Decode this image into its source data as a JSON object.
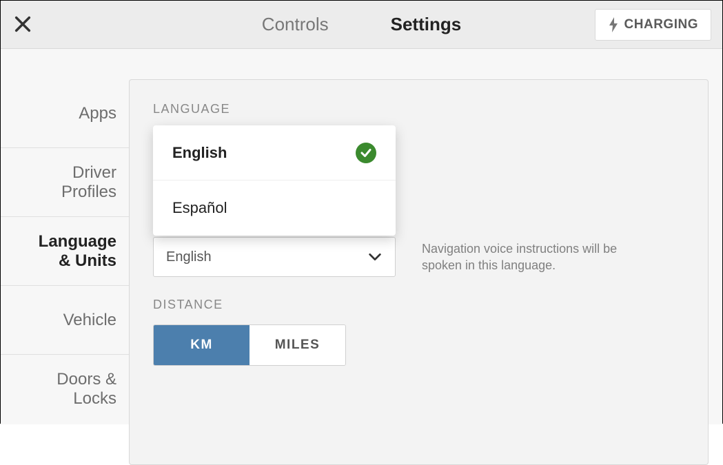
{
  "header": {
    "tabs": {
      "controls": "Controls",
      "settings": "Settings"
    },
    "charging": "CHARGING"
  },
  "sidebar": {
    "items": [
      {
        "label": "Apps"
      },
      {
        "label": "Driver\nProfiles"
      },
      {
        "label": "Language\n& Units"
      },
      {
        "label": "Vehicle"
      },
      {
        "label": "Doors &\nLocks"
      }
    ]
  },
  "sections": {
    "language_label": "LANGUAGE",
    "distance_label": "DISTANCE"
  },
  "language_dropdown": {
    "options": [
      {
        "label": "English",
        "selected": true
      },
      {
        "label": "Español",
        "selected": false
      }
    ]
  },
  "navigation": {
    "selected": "English",
    "hint": "Navigation voice instructions will be spoken in this language."
  },
  "distance": {
    "options": {
      "km": "KM",
      "miles": "MILES"
    },
    "selected": "km"
  }
}
